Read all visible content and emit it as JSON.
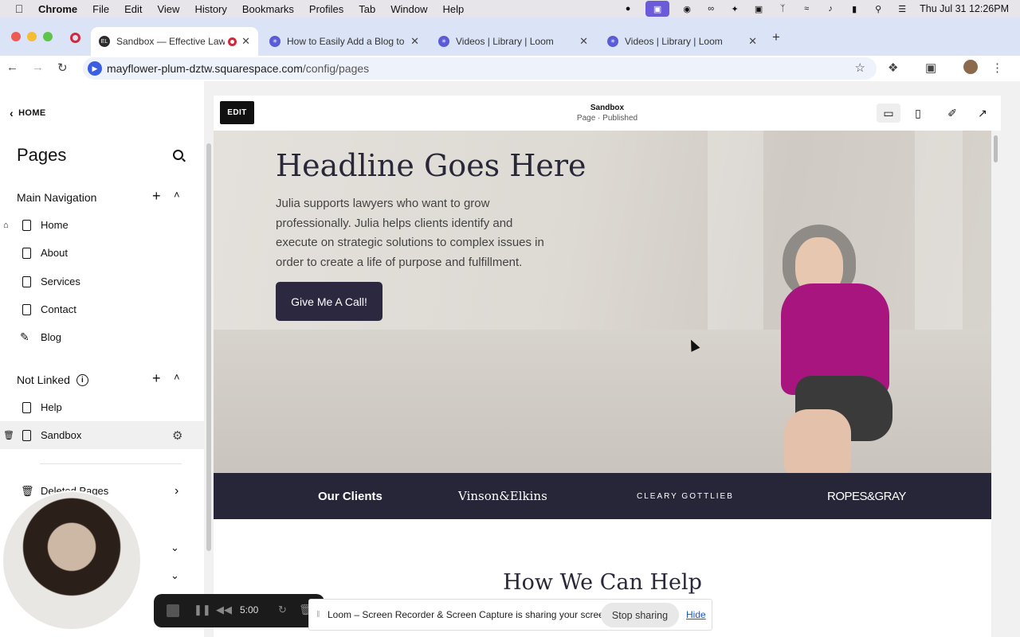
{
  "menubar": {
    "app": "Chrome",
    "items": [
      "File",
      "Edit",
      "View",
      "History",
      "Bookmarks",
      "Profiles",
      "Tab",
      "Window",
      "Help"
    ],
    "clock": "Thu Jul 31  12:26PM"
  },
  "tabs": [
    {
      "title": "Sandbox — Effective Lawy",
      "favicon": "EL",
      "color": "#2b2b2b"
    },
    {
      "title": "How to Easily Add a Blog to Y",
      "color": "#5b5bd6"
    },
    {
      "title": "Videos | Library | Loom",
      "color": "#5b5bd6"
    },
    {
      "title": "Videos | Library | Loom",
      "color": "#5b5bd6"
    }
  ],
  "omnibox": {
    "host": "mayflower-plum-dztw.squarespace.com",
    "path": "/config/pages"
  },
  "sidebar": {
    "back_label": "HOME",
    "title": "Pages",
    "main_nav": {
      "heading": "Main Navigation",
      "items": [
        "Home",
        "About",
        "Services",
        "Contact",
        "Blog"
      ]
    },
    "not_linked": {
      "heading": "Not Linked",
      "items": [
        "Help",
        "Sandbox"
      ]
    },
    "deleted": "Deleted Pages"
  },
  "preview_bar": {
    "edit": "EDIT",
    "page_title": "Sandbox",
    "page_status": "Page · Published"
  },
  "hero": {
    "headline": "Headline Goes Here",
    "body": "Julia supports lawyers who want to grow professionally. Julia helps clients identify and execute on strategic solutions to complex issues in order to create a life of purpose and fulfillment.",
    "cta": "Give Me A Call!"
  },
  "clients": {
    "label": "Our Clients",
    "logos": [
      "Vinson&Elkins",
      "CLEARY GOTTLIEB",
      "ROPES&GRAY"
    ]
  },
  "section2": {
    "heading": "How We Can Help"
  },
  "recorder": {
    "time": "5:00"
  },
  "sharing": {
    "message": "Loom – Screen Recorder & Screen Capture is sharing your screen.",
    "stop": "Stop sharing",
    "hide": "Hide"
  },
  "colors": {
    "accent": "#2b2840",
    "loom": "#6b5bd9",
    "blouse": "#a8157e"
  }
}
